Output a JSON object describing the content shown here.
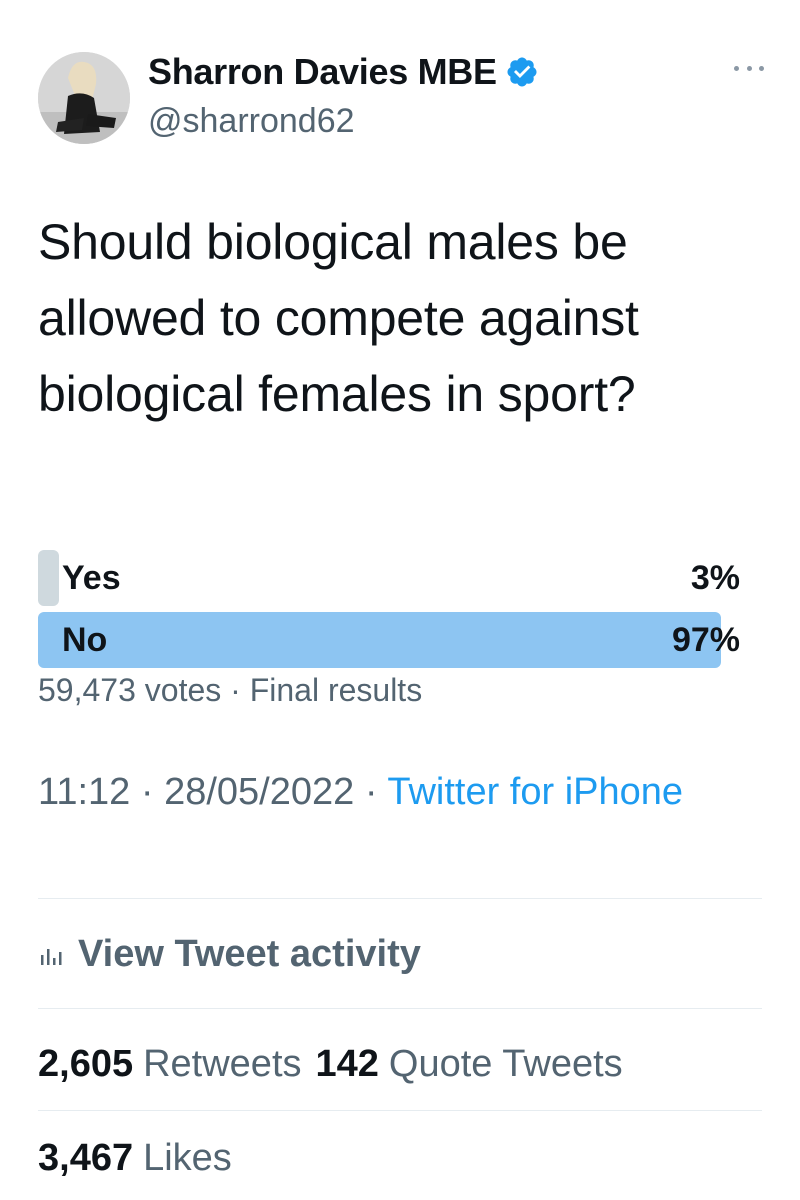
{
  "author": {
    "display_name": "Sharron Davies MBE",
    "handle": "@sharrond62",
    "verified_icon": "verified-badge-icon",
    "badge_color": "#1d9bf0"
  },
  "tweet": {
    "text": "Should biological males be allowed to compete against biological females in sport?"
  },
  "poll": {
    "options": [
      {
        "label": "Yes",
        "percent_text": "3%",
        "percent": 3
      },
      {
        "label": "No",
        "percent_text": "97%",
        "percent": 97
      }
    ],
    "votes": "59,473 votes",
    "separator": "·",
    "status": "Final results"
  },
  "meta": {
    "time": "11:12",
    "date": "28/05/2022",
    "separator": "·",
    "source": "Twitter for iPhone"
  },
  "activity": {
    "label": "View Tweet activity",
    "icon": "bar-chart-icon"
  },
  "stats": {
    "retweets_count": "2,605",
    "retweets_label": "Retweets",
    "quotes_count": "142",
    "quotes_label": "Quote Tweets",
    "likes_count": "3,467",
    "likes_label": "Likes"
  },
  "colors": {
    "link": "#1d9bf0",
    "secondary_text": "#536471",
    "winning_bar": "#8dc5f2",
    "losing_bar": "#cfd9de"
  }
}
